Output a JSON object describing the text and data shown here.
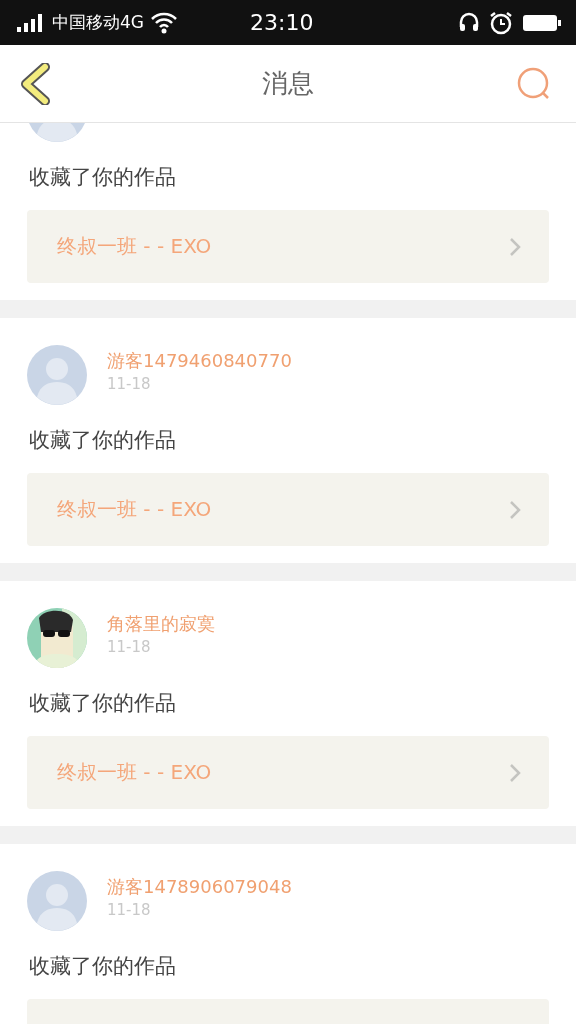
{
  "status_bar": {
    "carrier": "中国移动4G",
    "time": "23:10"
  },
  "header": {
    "title": "消息"
  },
  "messages": [
    {
      "kind": "default",
      "action": "收藏了你的作品",
      "work": "终叔一班 - - EXO"
    },
    {
      "kind": "default",
      "name": "游客1479460840770",
      "date": "11-18",
      "action": "收藏了你的作品",
      "work": "终叔一班 - - EXO"
    },
    {
      "name": "角落里的寂寞",
      "date": "11-18",
      "action": "收藏了你的作品",
      "work": "终叔一班 - - EXO"
    },
    {
      "kind": "default",
      "name": "游客1478906079048",
      "date": "11-18",
      "action": "收藏了你的作品"
    }
  ]
}
